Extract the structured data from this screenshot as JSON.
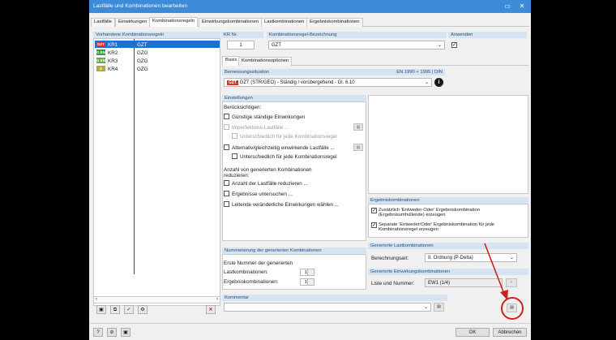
{
  "window": {
    "title": "Lastfälle und Kombinationen bearbeiten"
  },
  "tabs": [
    "Lastfälle",
    "Einwirkungen",
    "Kombinationsregeln",
    "Einwirkungskombinationen",
    "Lastkombinationen",
    "Ergebniskombinationen"
  ],
  "rules_list": {
    "header": "Vorhandene Kombinationsregeln",
    "rows": [
      {
        "badge": "GZT",
        "badge_color": "#d9302c",
        "name": "KR1",
        "type": "GZT",
        "selected": true
      },
      {
        "badge": "G EN",
        "badge_color": "#2f9e41",
        "name": "KR2",
        "type": "GZG",
        "selected": false
      },
      {
        "badge": "G EN",
        "badge_color": "#6aa84f",
        "name": "KR3",
        "type": "GZG",
        "selected": false
      },
      {
        "badge": "G CH",
        "badge_color": "#b5a642",
        "name": "KR4",
        "type": "GZG",
        "selected": false
      }
    ]
  },
  "header_fields": {
    "kr_label": "KR Nr.",
    "kr_value": "1",
    "name_label": "Kombinationsregel-Bezeichnung",
    "name_value": "GZT",
    "apply_label": "Anwenden",
    "apply_checked": "✓"
  },
  "sub_tabs": [
    "Basis",
    "Kombinationsoptionen"
  ],
  "design_situation": {
    "header": "Bemessungssituation",
    "norm": "EN 1990 + 1995 | DIN",
    "badge": "GZT",
    "value": "GZT (STR/GEO) - Ständig / vorübergehend - Gl. 6.10"
  },
  "settings": {
    "header": "Einstellungen",
    "consider_label": "Berücksichtigen:",
    "options": [
      {
        "label": "Günstige ständige Einwirkungen",
        "checked": "",
        "disabled": false,
        "indent": false
      },
      {
        "label": "Imperfektions-Lastfälle ...",
        "checked": "",
        "disabled": true,
        "indent": false
      },
      {
        "label": "Unterschiedlich für jede Kombinationsregel",
        "checked": "",
        "disabled": true,
        "indent": true
      },
      {
        "label": "Alternativ/gleichzeitig einwirkende Lastfälle ...",
        "checked": "",
        "disabled": false,
        "indent": false
      },
      {
        "label": "Unterschiedlich für jede Kombinationsregel",
        "checked": "",
        "disabled": false,
        "indent": true
      }
    ],
    "reduce_label_1": "Anzahl von generierten Kombinationen",
    "reduce_label_2": "reduzieren:",
    "reduce_options": [
      {
        "label": "Anzahl der Lastfälle reduzieren ...",
        "checked": ""
      },
      {
        "label": "Ergebnisse untersuchen ...",
        "checked": ""
      },
      {
        "label": "Leitende veränderliche Einwirkungen wählen ...",
        "checked": ""
      }
    ]
  },
  "numbering": {
    "header": "Nummerierung der generierten Kombinationen",
    "first_label": "Erste Nummer der generierten",
    "lk_label": "Lastkombinationen:",
    "lk_value": "1",
    "ek_label": "Ergebniskombinationen:",
    "ek_value": "1"
  },
  "result_combos": {
    "header": "Ergebniskombinationen",
    "opt1": "Zusätzlich 'Entweder-Oder' Ergebniskombination (Ergebnisumhüllende) erzeugen",
    "opt1_checked": "✓",
    "opt2": "Separate 'Entweder/Oder' Ergebniskombination für jede Kombinationsregel erzeugen",
    "opt2_checked": "✓"
  },
  "generated_lk": {
    "header": "Generierte Lastkombinationen",
    "method_label": "Berechnungsart:",
    "method_value": "II. Ordnung (P-Delta)"
  },
  "generated_ek": {
    "header": "Generierte Einwirkungskombinationen",
    "list_label": "Liste und Nummer:",
    "list_value": "EW1 (1/4)"
  },
  "comment": {
    "header": "Kommentar",
    "value": ""
  },
  "footer": {
    "ok": "OK",
    "cancel": "Abbrechen"
  },
  "colors": {
    "title_bar": "#3c8ad8",
    "selection": "#1e6fcf",
    "annotation": "#d0201e"
  }
}
